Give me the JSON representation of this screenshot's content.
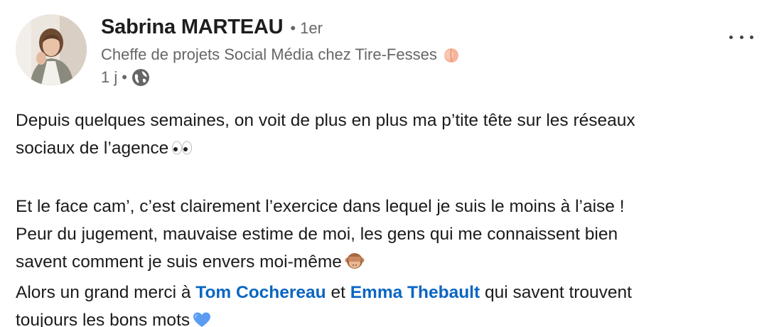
{
  "author": {
    "name": "Sabrina MARTEAU",
    "degree": "1er",
    "headline": "Cheffe de projets Social Média chez Tire-Fesses",
    "headline_emoji": "peach-icon",
    "time": "1 j",
    "visibility_icon": "globe-icon"
  },
  "post": {
    "line1": "Depuis quelques semaines, on voit de plus en plus ma p’tite tête sur les réseaux",
    "line2": "sociaux de l’agence",
    "line3": "Et le face cam’, c’est clairement l’exercice dans lequel je suis le moins à l’aise !",
    "line4": "Peur du jugement, mauvaise estime de moi, les gens qui me connaissent bien",
    "line5": "savent comment je suis envers moi-même",
    "line6_before": "Alors un grand merci à",
    "mention1": "Tom Cochereau",
    "line6_and": "et",
    "mention2": "Emma Thebault",
    "line6_after": "qui savent trouvent",
    "line7": "toujours les bons mots"
  },
  "colors": {
    "mention": "#0a66c2",
    "secondary_text": "#666666"
  }
}
